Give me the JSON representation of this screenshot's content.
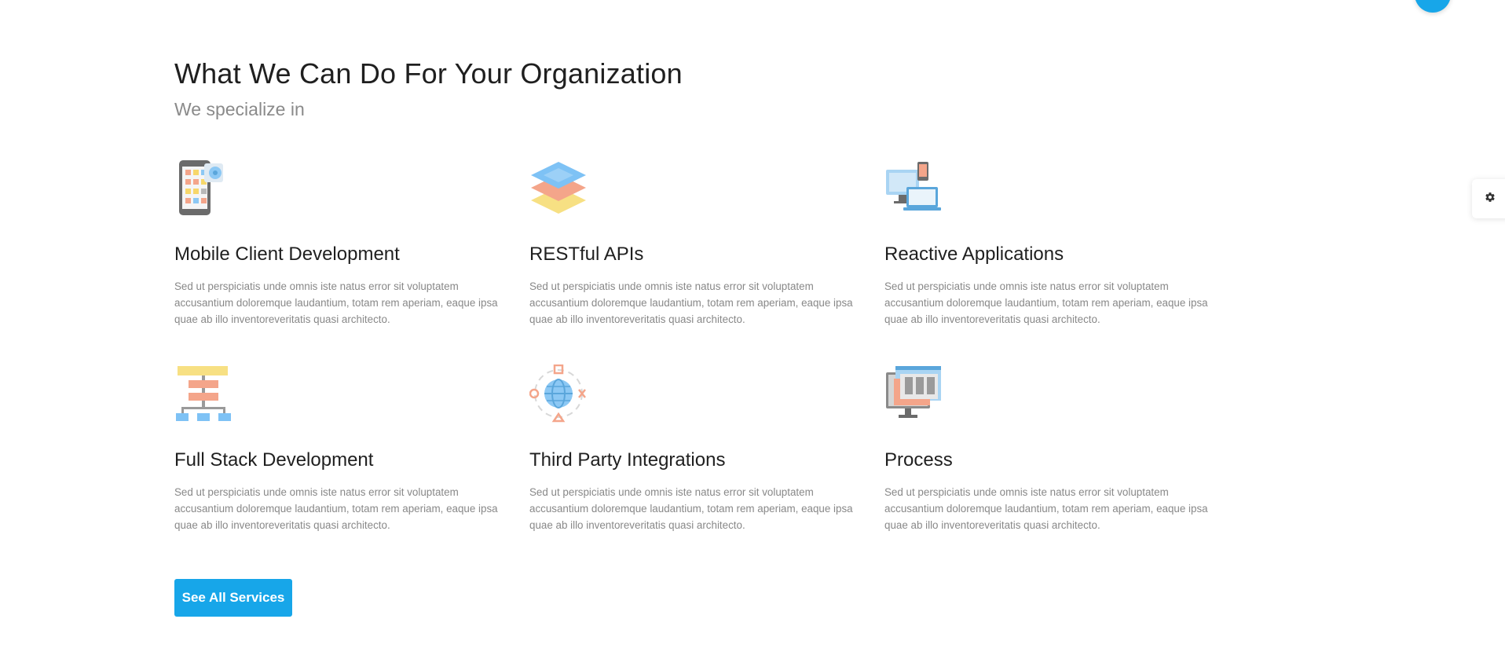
{
  "header": {
    "title": "What We Can Do For Your Organization",
    "subtitle": "We specialize in"
  },
  "services": [
    {
      "title": "Mobile Client Development",
      "description": "Sed ut perspiciatis unde omnis iste natus error sit voluptatem accusantium doloremque laudantium, totam rem aperiam, eaque ipsa quae ab illo inventoreveritatis quasi architecto.",
      "icon": "mobile-app-icon"
    },
    {
      "title": "RESTful APIs",
      "description": "Sed ut perspiciatis unde omnis iste natus error sit voluptatem accusantium doloremque laudantium, totam rem aperiam, eaque ipsa quae ab illo inventoreveritatis quasi architecto.",
      "icon": "layers-icon"
    },
    {
      "title": "Reactive Applications",
      "description": "Sed ut perspiciatis unde omnis iste natus error sit voluptatem accusantium doloremque laudantium, totam rem aperiam, eaque ipsa quae ab illo inventoreveritatis quasi architecto.",
      "icon": "devices-icon"
    },
    {
      "title": "Full Stack Development",
      "description": "Sed ut perspiciatis unde omnis iste natus error sit voluptatem accusantium doloremque laudantium, totam rem aperiam, eaque ipsa quae ab illo inventoreveritatis quasi architecto.",
      "icon": "hierarchy-icon"
    },
    {
      "title": "Third Party Integrations",
      "description": "Sed ut perspiciatis unde omnis iste natus error sit voluptatem accusantium doloremque laudantium, totam rem aperiam, eaque ipsa quae ab illo inventoreveritatis quasi architecto.",
      "icon": "globe-network-icon"
    },
    {
      "title": "Process",
      "description": "Sed ut perspiciatis unde omnis iste natus error sit voluptatem accusantium doloremque laudantium, totam rem aperiam, eaque ipsa quae ab illo inventoreveritatis quasi architecto.",
      "icon": "monitor-process-icon"
    }
  ],
  "cta": {
    "label": "See All Services"
  },
  "widgets": {
    "fab_icon": "scroll-top-icon",
    "settings_icon": "gear-icon"
  },
  "colors": {
    "accent": "#17a6e9",
    "heading": "#1f1f1f",
    "muted": "#888888"
  }
}
